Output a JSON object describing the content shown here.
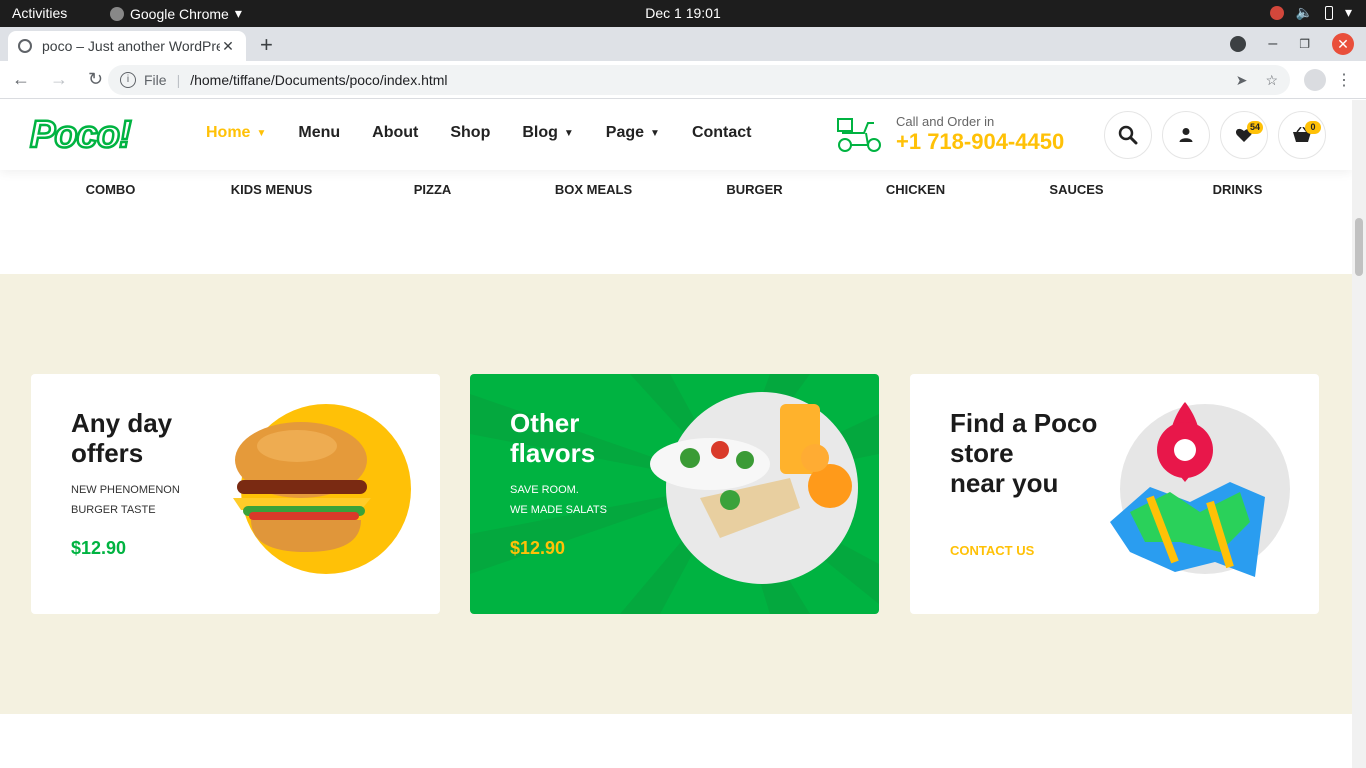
{
  "os": {
    "activities": "Activities",
    "app_name": "Google Chrome",
    "clock": "Dec 1  19:01"
  },
  "browser": {
    "tab_title": "poco – Just another WordPress site",
    "scheme": "File",
    "url": "/home/tiffane/Documents/poco/index.html"
  },
  "site": {
    "logo": "Poco!",
    "nav": [
      {
        "label": "Home",
        "dropdown": true,
        "active": true
      },
      {
        "label": "Menu"
      },
      {
        "label": "About"
      },
      {
        "label": "Shop"
      },
      {
        "label": "Blog",
        "dropdown": true
      },
      {
        "label": "Page",
        "dropdown": true
      },
      {
        "label": "Contact"
      }
    ],
    "call_label": "Call and Order in",
    "phone": "+1 718-904-4450",
    "wishlist_count": "54",
    "cart_count": "0",
    "categories": [
      "COMBO",
      "KIDS MENUS",
      "PIZZA",
      "BOX MEALS",
      "BURGER",
      "CHICKEN",
      "SAUCES",
      "DRINKS"
    ]
  },
  "promos": [
    {
      "title_line1": "Any day",
      "title_line2": "offers",
      "sub_line1": "NEW PHENOMENON",
      "sub_line2": "BURGER TASTE",
      "price": "$12.90"
    },
    {
      "title_line1": "Other",
      "title_line2": "flavors",
      "sub_line1": "SAVE ROOM.",
      "sub_line2": "WE MADE SALATS",
      "price": "$12.90"
    },
    {
      "title_line1": "Find a Poco",
      "title_line2": "store",
      "title_line3": "near you",
      "link": "CONTACT US"
    }
  ],
  "colors": {
    "brand_green": "#00b341",
    "brand_yellow": "#ffc107",
    "band": "#f4f1e0"
  }
}
